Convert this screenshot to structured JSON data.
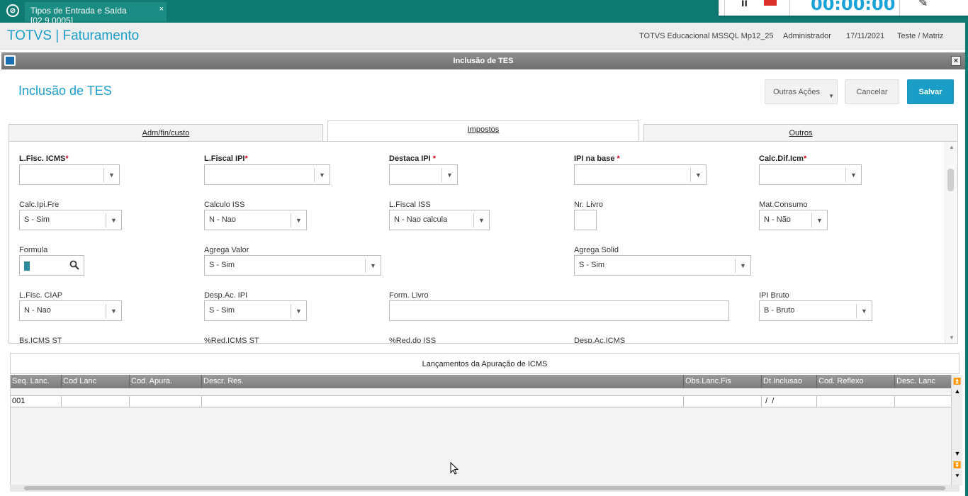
{
  "taskbar": {
    "tab_label": "Tipos de Entrada e Saída [02.9.0005]",
    "close_glyph": "×",
    "timer": "00:00:00",
    "colors": {
      "bg": "#0e7a72",
      "timer": "#1aa3d8",
      "stop": "#d9302c"
    }
  },
  "header": {
    "brand": "TOTVS | Faturamento",
    "environment": "TOTVS Educacional MSSQL Mp12_25",
    "user": "Administrador",
    "date": "17/11/2021",
    "branch": "Teste / Matriz"
  },
  "window": {
    "title": "Inclusão de TES",
    "close_glyph": "×"
  },
  "page": {
    "title": "Inclusão de TES"
  },
  "actions": {
    "other": "Outras Ações",
    "cancel": "Cancelar",
    "save": "Salvar"
  },
  "tabs": [
    {
      "label": "Adm/fin/custo"
    },
    {
      "label": "Impostos"
    },
    {
      "label": "Outros"
    }
  ],
  "fields": {
    "lfisc_icms": {
      "label": "L.Fisc. ICMS",
      "value": ""
    },
    "lfiscal_ipi": {
      "label": "L.Fiscal IPI",
      "value": ""
    },
    "destaca_ipi": {
      "label": "Destaca IPI ",
      "value": ""
    },
    "ipi_na_base": {
      "label": "IPI na base ",
      "value": ""
    },
    "calc_dif_icm": {
      "label": "Calc.Dif.Icm",
      "value": ""
    },
    "calc_ipi_fre": {
      "label": "Calc.Ipi.Fre",
      "value": "S - Sim"
    },
    "calculo_iss": {
      "label": "Calculo ISS",
      "value": "N - Nao"
    },
    "lfiscal_iss": {
      "label": "L.Fiscal ISS",
      "value": "N - Nao calcula"
    },
    "nr_livro": {
      "label": "Nr. Livro",
      "value": ""
    },
    "mat_consumo": {
      "label": "Mat.Consumo",
      "value": "N - Não"
    },
    "formula": {
      "label": "Formula",
      "value": ""
    },
    "agrega_valor": {
      "label": "Agrega Valor",
      "value": "S - Sim"
    },
    "agrega_solid": {
      "label": "Agrega Solid",
      "value": "S - Sim"
    },
    "lfisc_ciap": {
      "label": "L.Fisc. CIAP",
      "value": "N - Nao"
    },
    "desp_ac_ipi": {
      "label": "Desp.Ac. IPI",
      "value": "S - Sim"
    },
    "form_livro": {
      "label": "Form. Livro",
      "value": ""
    },
    "ipi_bruto": {
      "label": "IPI Bruto",
      "value": "B - Bruto"
    },
    "bs_icms_st": {
      "label": "Bs.ICMS ST"
    },
    "red_icms_st": {
      "label": "%Red.ICMS ST"
    },
    "red_do_iss": {
      "label": "%Red.do ISS"
    },
    "desp_ac_icms": {
      "label": "Desp.Ac.ICMS"
    }
  },
  "required_mark": "*",
  "grid": {
    "title": "Lançamentos da Apuração de ICMS",
    "columns": [
      "Seq. Lanc.",
      "Cod Lanc",
      "Cod. Apura.",
      "Descr. Res.",
      "Obs.Lanc.Fis",
      "Dt.Inclusao",
      "Cod. Reflexo",
      "Desc. Lanc"
    ],
    "rows": [
      [
        "001",
        "",
        "",
        "",
        "",
        " /  /",
        "",
        ""
      ]
    ]
  }
}
